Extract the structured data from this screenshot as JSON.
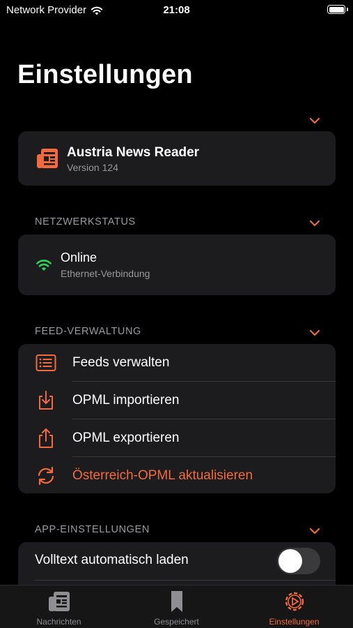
{
  "status_bar": {
    "carrier": "Network Provider",
    "time": "21:08"
  },
  "page": {
    "title": "Einstellungen"
  },
  "app_info": {
    "name": "Austria News Reader",
    "version": "Version 124"
  },
  "network": {
    "header": "NETZWERKSTATUS",
    "status": "Online",
    "detail": "Ethernet-Verbindung",
    "status_color": "#30d158"
  },
  "feeds": {
    "header": "FEED-VERWALTUNG",
    "items": [
      {
        "label": "Feeds verwalten",
        "icon": "list-icon"
      },
      {
        "label": "OPML importieren",
        "icon": "import-icon"
      },
      {
        "label": "OPML exportieren",
        "icon": "share-icon"
      },
      {
        "label": "Österreich-OPML aktualisieren",
        "icon": "refresh-icon"
      }
    ]
  },
  "app_settings": {
    "header": "APP-EINSTELLUNGEN",
    "fulltext_label": "Volltext automatisch laden",
    "fulltext_enabled": false
  },
  "tabs": [
    {
      "label": "Nachrichten",
      "icon": "newspaper-icon",
      "active": false
    },
    {
      "label": "Gespeichert",
      "icon": "bookmark-icon",
      "active": false
    },
    {
      "label": "Einstellungen",
      "icon": "settings-icon",
      "active": true
    }
  ],
  "colors": {
    "accent": "#f26a3d",
    "background": "#000000",
    "card": "#1c1c1e"
  }
}
